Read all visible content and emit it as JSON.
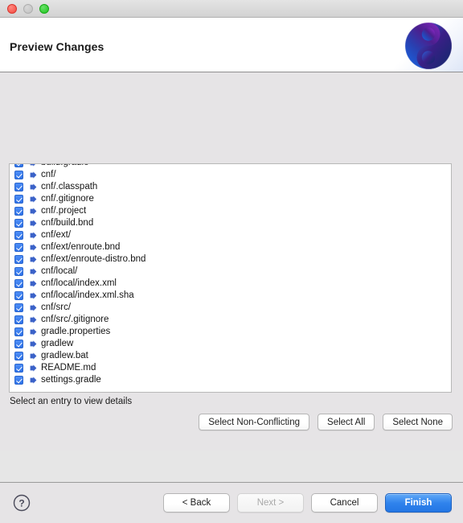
{
  "window": {
    "traffic_lights": [
      "close",
      "minimize",
      "maximize"
    ]
  },
  "header": {
    "title": "Preview Changes",
    "logo_icon": "enroute-swirl-logo"
  },
  "file_list": {
    "rows": [
      {
        "label": "build.gradle",
        "checked": true,
        "clipped": true
      },
      {
        "label": "cnf/",
        "checked": true
      },
      {
        "label": "cnf/.classpath",
        "checked": true
      },
      {
        "label": "cnf/.gitignore",
        "checked": true
      },
      {
        "label": "cnf/.project",
        "checked": true
      },
      {
        "label": "cnf/build.bnd",
        "checked": true
      },
      {
        "label": "cnf/ext/",
        "checked": true
      },
      {
        "label": "cnf/ext/enroute.bnd",
        "checked": true
      },
      {
        "label": "cnf/ext/enroute-distro.bnd",
        "checked": true
      },
      {
        "label": "cnf/local/",
        "checked": true
      },
      {
        "label": "cnf/local/index.xml",
        "checked": true
      },
      {
        "label": "cnf/local/index.xml.sha",
        "checked": true
      },
      {
        "label": "cnf/src/",
        "checked": true
      },
      {
        "label": "cnf/src/.gitignore",
        "checked": true
      },
      {
        "label": "gradle.properties",
        "checked": true
      },
      {
        "label": "gradlew",
        "checked": true
      },
      {
        "label": "gradlew.bat",
        "checked": true
      },
      {
        "label": "README.md",
        "checked": true
      },
      {
        "label": "settings.gradle",
        "checked": true
      }
    ]
  },
  "status": {
    "text": "Select an entry to view details"
  },
  "selection_buttons": {
    "non_conflicting": "Select Non-Conflicting",
    "all": "Select All",
    "none": "Select None"
  },
  "footer": {
    "help_icon": "question-mark-icon",
    "back": "< Back",
    "next": "Next >",
    "cancel": "Cancel",
    "finish": "Finish"
  },
  "colors": {
    "accent_blue": "#2f82ec",
    "checkbox_blue": "#3b7ef0",
    "arrow_blue": "#3b62c8",
    "window_bg": "#e6e4e6",
    "list_bg": "#ffffff"
  }
}
